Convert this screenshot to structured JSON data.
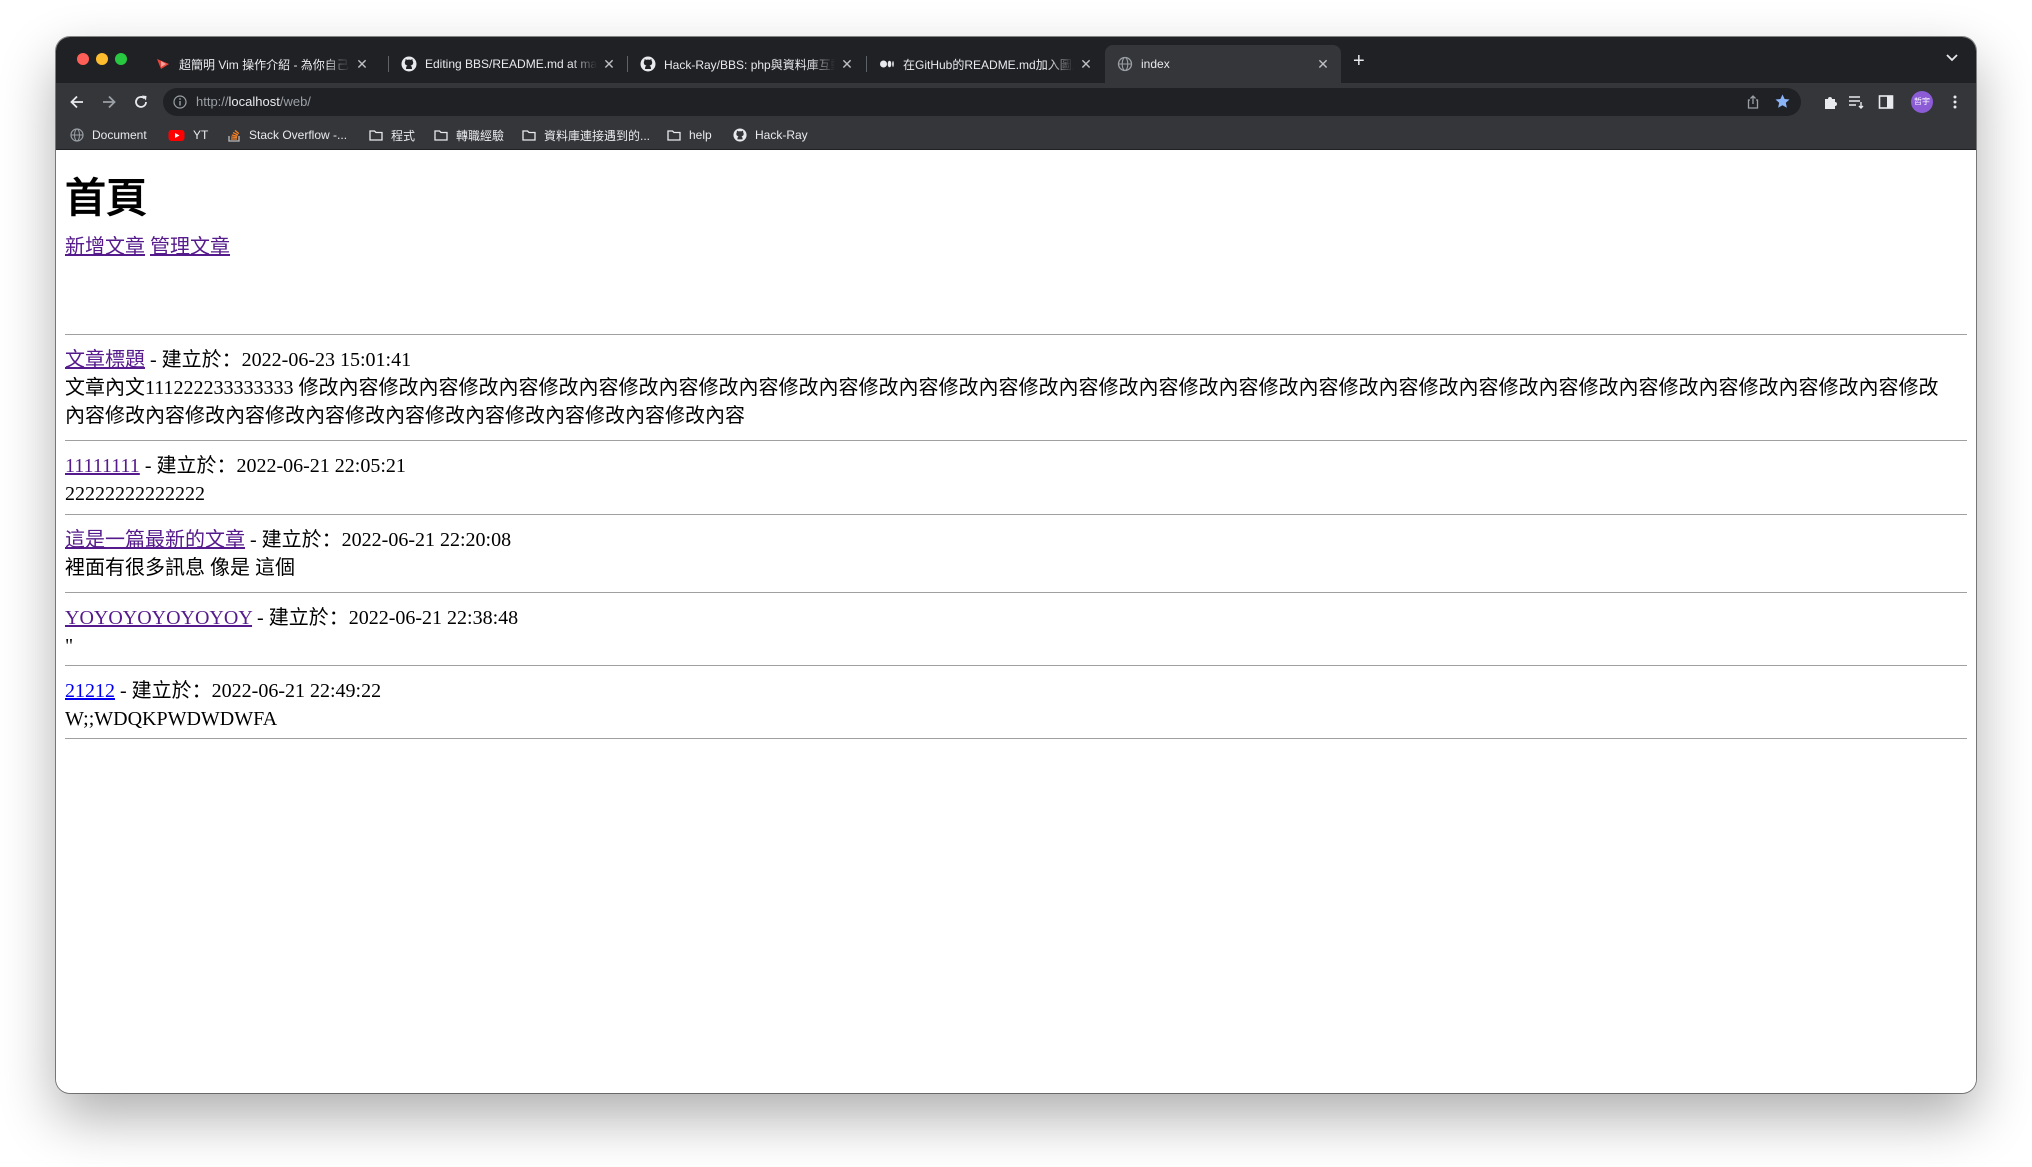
{
  "browser": {
    "tabs": [
      {
        "title": "超簡明 Vim 操作介紹 - 為你自己",
        "favicon": "vim-icon"
      },
      {
        "title": "Editing BBS/README.md at main",
        "favicon": "github-icon"
      },
      {
        "title": "Hack-Ray/BBS: php與資料庫互動",
        "favicon": "github-icon"
      },
      {
        "title": "在GitHub的README.md加入圖片",
        "favicon": "medium-icon"
      },
      {
        "title": "index",
        "favicon": "globe-icon"
      }
    ],
    "url_prefix": "http://",
    "url_host": "localhost",
    "url_path": "/web/",
    "avatar_text": "哲宇",
    "bookmarks": [
      "Document",
      "YT",
      "Stack Overflow -...",
      "程式",
      "轉職經驗",
      "資料庫連接遇到的...",
      "help",
      "Hack-Ray"
    ],
    "colors": {
      "chrome_dark": "#202124",
      "chrome_toolbar": "#35363a",
      "star_blue": "#8ab4f8",
      "avatar": "#8c5bd6"
    }
  },
  "page": {
    "heading": "首頁",
    "nav": {
      "add": "新增文章",
      "manage": "管理文章"
    },
    "created_label": " - 建立於：",
    "posts": [
      {
        "title": "文章標題",
        "created": "2022-06-23 15:01:41",
        "body": "文章內文111222233333333 修改內容修改內容修改內容修改內容修改內容修改內容修改內容修改內容修改內容修改內容修改內容修改內容修改內容修改內容修改內容修改內容修改內容修改內容修改內容修改內容修改內容修改內容修改內容修改內容修改內容修改內容修改內容修改內容修改內容"
      },
      {
        "title": "11111111",
        "created": "2022-06-21 22:05:21",
        "body": "22222222222222"
      },
      {
        "title": "這是一篇最新的文章",
        "created": "2022-06-21 22:20:08",
        "body": "裡面有很多訊息 像是 這個"
      },
      {
        "title": "YOYOYOYOYOYOY",
        "created": "2022-06-21 22:38:48",
        "body": "\""
      },
      {
        "title": "21212",
        "created": "2022-06-21 22:49:22",
        "body": "W;;WDQKPWDWDWFA"
      }
    ],
    "colors": {
      "link_visited": "#551a8b",
      "link_unvisited": "#0000ee"
    }
  }
}
